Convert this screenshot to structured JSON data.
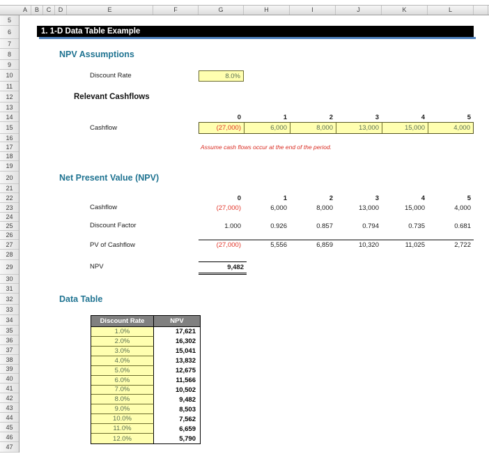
{
  "colors": {
    "section_heading": "#1F7391",
    "title_bar_bg": "#000000",
    "title_bar_text": "#FFFFFF",
    "title_underline": "#4E81BD",
    "input_cell_bg": "#FFFFB0",
    "input_text": "#5A7052",
    "negative_red": "#E2362A",
    "note_red": "#D92B21",
    "table_header_bg": "#808080",
    "table_header_text": "#FFFFFF"
  },
  "grid": {
    "column_headers": [
      "A",
      "B",
      "C",
      "D",
      "E",
      "F",
      "G",
      "H",
      "I",
      "J",
      "K",
      "L"
    ],
    "row_headers": [
      "5",
      "6",
      "7",
      "8",
      "9",
      "10",
      "11",
      "12",
      "13",
      "14",
      "15",
      "16",
      "17",
      "18",
      "19",
      "20",
      "21",
      "22",
      "23",
      "24",
      "25",
      "26",
      "27",
      "28",
      "29",
      "30",
      "31",
      "32",
      "33",
      "34",
      "35",
      "36",
      "37",
      "38",
      "39",
      "40",
      "41",
      "42",
      "43",
      "44",
      "45",
      "46",
      "47"
    ]
  },
  "title": "1. 1-D Data Table Example",
  "assumptions": {
    "heading": "NPV Assumptions",
    "discount_rate_label": "Discount Rate",
    "discount_rate_value": "8.0%"
  },
  "cashflows": {
    "heading": "Relevant Cashflows",
    "periods": [
      "0",
      "1",
      "2",
      "3",
      "4",
      "5"
    ],
    "row_label": "Cashflow",
    "values": [
      "(27,000)",
      "6,000",
      "8,000",
      "13,000",
      "15,000",
      "4,000"
    ],
    "note": "Assume cash flows occur at the end of the period."
  },
  "npv_section": {
    "heading": "Net Present Value (NPV)",
    "periods": [
      "0",
      "1",
      "2",
      "3",
      "4",
      "5"
    ],
    "rows": [
      {
        "label": "Cashflow",
        "values": [
          "(27,000)",
          "6,000",
          "8,000",
          "13,000",
          "15,000",
          "4,000"
        ]
      },
      {
        "label": "Discount Factor",
        "values": [
          "1.000",
          "0.926",
          "0.857",
          "0.794",
          "0.735",
          "0.681"
        ]
      },
      {
        "label": "PV of Cashflow",
        "values": [
          "(27,000)",
          "5,556",
          "6,859",
          "10,320",
          "11,025",
          "2,722"
        ]
      }
    ],
    "npv_label": "NPV",
    "npv_value": "9,482"
  },
  "data_table": {
    "heading": "Data Table",
    "columns": [
      "Discount Rate",
      "NPV"
    ],
    "rows": [
      [
        "1.0%",
        "17,621"
      ],
      [
        "2.0%",
        "16,302"
      ],
      [
        "3.0%",
        "15,041"
      ],
      [
        "4.0%",
        "13,832"
      ],
      [
        "5.0%",
        "12,675"
      ],
      [
        "6.0%",
        "11,566"
      ],
      [
        "7.0%",
        "10,502"
      ],
      [
        "8.0%",
        "9,482"
      ],
      [
        "9.0%",
        "8,503"
      ],
      [
        "10.0%",
        "7,562"
      ],
      [
        "11.0%",
        "6,659"
      ],
      [
        "12.0%",
        "5,790"
      ]
    ]
  }
}
